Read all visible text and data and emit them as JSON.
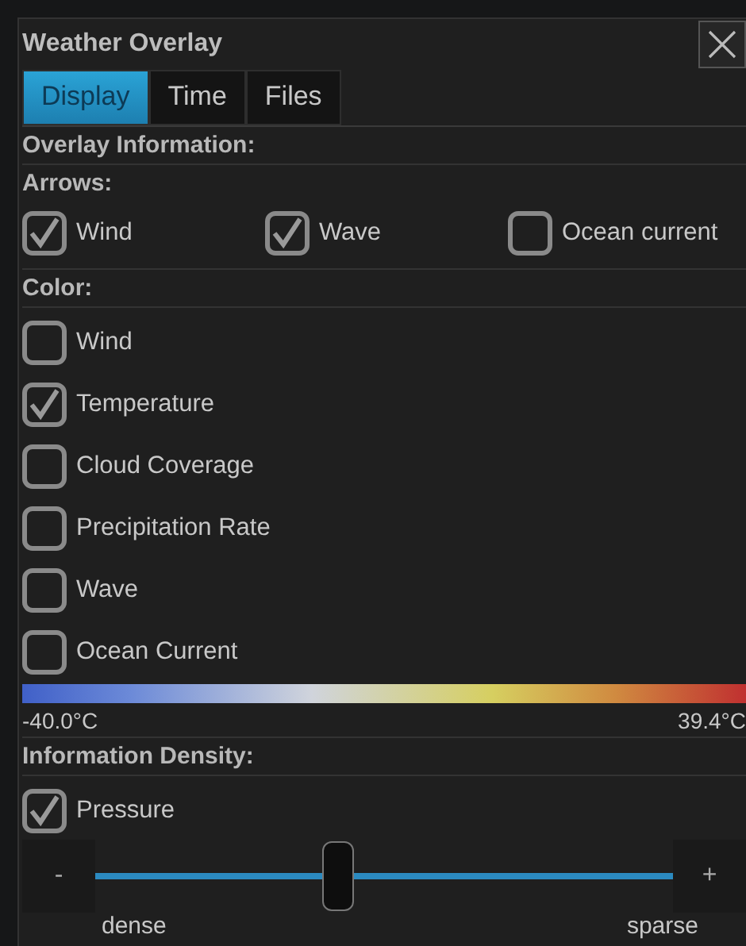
{
  "window": {
    "title": "Weather Overlay"
  },
  "tabs": [
    {
      "label": "Display",
      "selected": true
    },
    {
      "label": "Time",
      "selected": false
    },
    {
      "label": "Files",
      "selected": false
    }
  ],
  "overlay_header": "Overlay Information:",
  "arrows": {
    "label": "Arrows:",
    "options": [
      {
        "label": "Wind",
        "checked": true
      },
      {
        "label": "Wave",
        "checked": true
      },
      {
        "label": "Ocean current",
        "checked": false
      }
    ]
  },
  "color": {
    "label": "Color:",
    "options": [
      {
        "label": "Wind",
        "checked": false
      },
      {
        "label": "Temperature",
        "checked": true
      },
      {
        "label": "Cloud Coverage",
        "checked": false
      },
      {
        "label": "Precipitation Rate",
        "checked": false
      },
      {
        "label": "Wave",
        "checked": false
      },
      {
        "label": "Ocean Current",
        "checked": false
      }
    ],
    "legend_min": "-40.0°C",
    "legend_max": "39.4°C"
  },
  "density": {
    "label": "Information Density:",
    "option": {
      "label": "Pressure",
      "checked": true
    },
    "slider": {
      "minus": "-",
      "plus": "+",
      "level": 0.42,
      "min_label": "dense",
      "max_label": "sparse"
    }
  }
}
